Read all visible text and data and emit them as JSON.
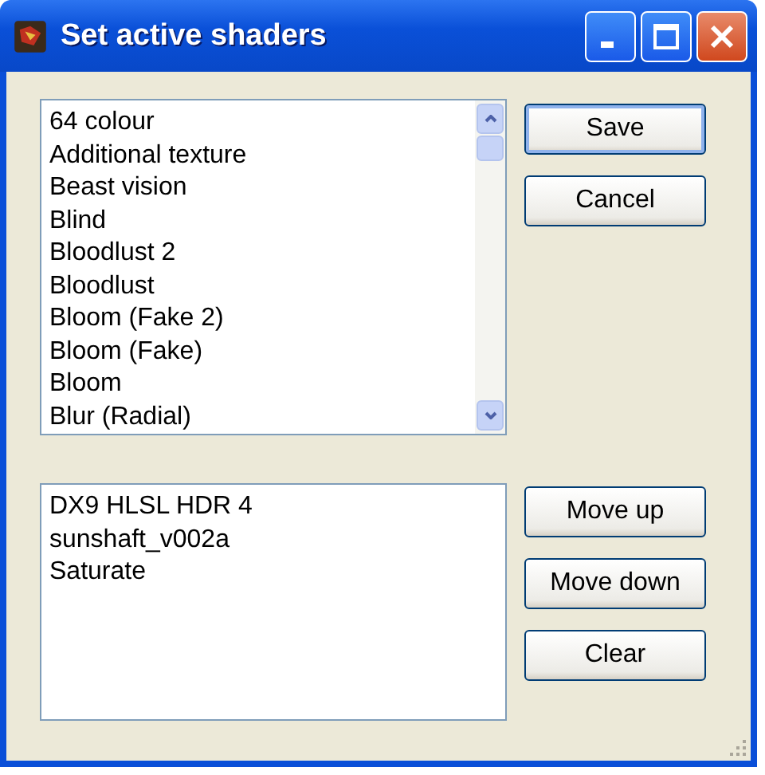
{
  "window": {
    "title": "Set active shaders"
  },
  "available_shaders": {
    "items": [
      "64 colour",
      "Additional texture",
      "Beast vision",
      "Blind",
      "Bloodlust 2",
      "Bloodlust",
      "Bloom (Fake 2)",
      "Bloom (Fake)",
      "Bloom",
      "Blur (Radial)"
    ]
  },
  "top_buttons": [
    {
      "label": "Save",
      "default": true
    },
    {
      "label": "Cancel",
      "default": false
    }
  ],
  "active_shaders": {
    "items": [
      "DX9 HLSL HDR 4",
      "sunshaft_v002a",
      "Saturate"
    ]
  },
  "bottom_buttons": [
    {
      "label": "Move up",
      "default": false
    },
    {
      "label": "Move down",
      "default": false
    },
    {
      "label": "Clear",
      "default": false
    }
  ]
}
